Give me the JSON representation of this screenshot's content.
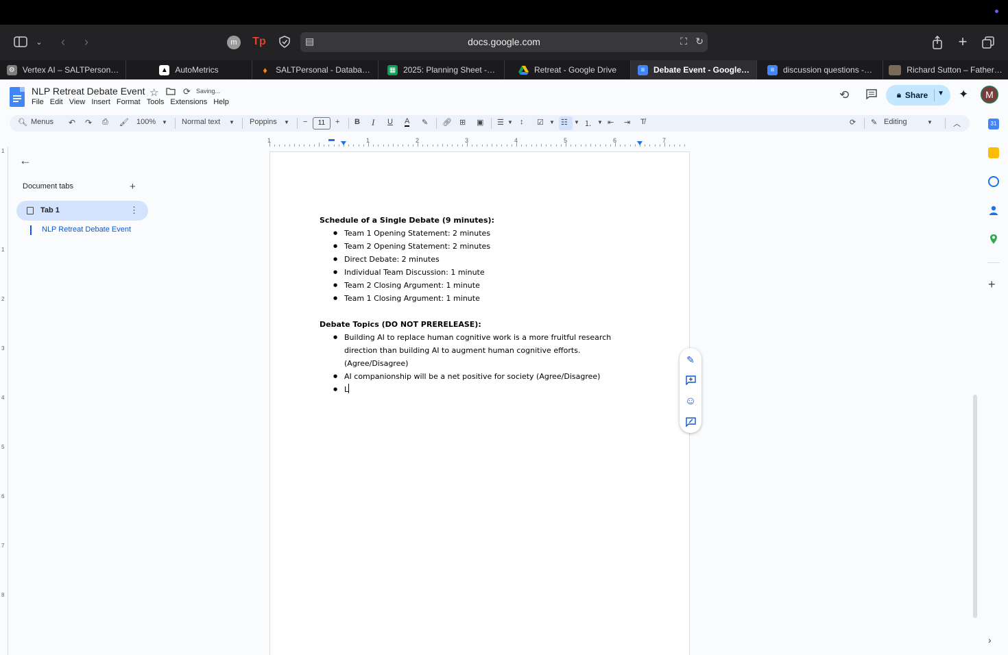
{
  "browser": {
    "url": "docs.google.com",
    "tabs": [
      {
        "label": "Vertex AI – SALTPerson…",
        "icon": "gear-icon",
        "color": "#8e8e8e"
      },
      {
        "label": "AutoMetrics",
        "icon": "triangle-logo-icon",
        "color": "#ffffff"
      },
      {
        "label": "SALTPersonal - Databa…",
        "icon": "firebase-flame-icon",
        "color": "#f6820d"
      },
      {
        "label": "2025: Planning Sheet -…",
        "icon": "sheets-icon",
        "color": "#0f9d58"
      },
      {
        "label": "Retreat - Google Drive",
        "icon": "drive-icon",
        "color": "#fbbc04"
      },
      {
        "label": "Debate Event - Google…",
        "icon": "docs-icon",
        "color": "#4285f4",
        "active": true
      },
      {
        "label": "discussion questions -…",
        "icon": "docs-icon",
        "color": "#4285f4"
      },
      {
        "label": "Richard Sutton – Father…",
        "icon": "thumbnail-icon",
        "color": "#7a6a58"
      }
    ]
  },
  "doc": {
    "title": "NLP Retreat Debate Event",
    "status": "Saving...",
    "menus": [
      "File",
      "Edit",
      "View",
      "Insert",
      "Format",
      "Tools",
      "Extensions",
      "Help"
    ],
    "share_label": "Share",
    "avatar_letter": "M"
  },
  "toolbar": {
    "search_label": "Menus",
    "zoom": "100%",
    "style": "Normal text",
    "font": "Poppins",
    "font_size": "11",
    "mode": "Editing"
  },
  "ruler": {
    "numbers": [
      "1",
      "1",
      "2",
      "3",
      "4",
      "5",
      "6",
      "7"
    ]
  },
  "vruler": {
    "numbers": [
      "1",
      "1",
      "2",
      "3",
      "4",
      "5",
      "6",
      "7",
      "8"
    ]
  },
  "sidebar": {
    "heading": "Document tabs",
    "tab_label": "Tab 1",
    "outline_item": "NLP Retreat Debate Event"
  },
  "content": {
    "schedule_heading": "Schedule of a Single Debate (9 minutes):",
    "schedule_items": [
      "Team 1 Opening Statement: 2 minutes",
      "Team 2 Opening Statement: 2 minutes",
      "Direct Debate: 2 minutes",
      "Individual Team Discussion: 1 minute",
      "Team 2 Closing Argument: 1 minute",
      "Team 1 Closing Argument: 1 minute"
    ],
    "topics_heading": "Debate Topics (DO NOT PRERELEASE):",
    "topic_items": [
      "Building AI to replace human cognitive work is a more fruitful research direction than building AI to augment human cognitive efforts. (Agree/Disagree)",
      "AI companionship will be a net positive for society (Agree/Disagree)",
      "L"
    ]
  }
}
